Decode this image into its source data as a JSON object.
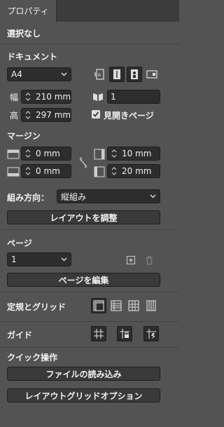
{
  "tab": {
    "label": "プロパティ"
  },
  "selection": {
    "label": "選択なし"
  },
  "document": {
    "header": "ドキュメント",
    "page_size": "A4",
    "width_label": "幅",
    "width_value": "210 mm",
    "height_label": "高",
    "height_value": "297 mm",
    "pages_value": "1",
    "facing_pages": {
      "label": "見開きページ",
      "checked": true
    }
  },
  "margins": {
    "header": "マージン",
    "top": "0 mm",
    "bottom": "0 mm",
    "inside": "10 mm",
    "outside": "20 mm"
  },
  "direction": {
    "label": "組み方向：",
    "value": "縦組み"
  },
  "layout_adjust": {
    "label": "レイアウトを調整"
  },
  "pages": {
    "header": "ページ",
    "current": "1",
    "edit_label": "ページを編集"
  },
  "grids": {
    "header": "定規とグリッド"
  },
  "guides": {
    "header": "ガイド"
  },
  "quick_actions": {
    "header": "クイック操作",
    "import_file": "ファイルの読み込み",
    "layout_grid_options": "レイアウトグリッドオプション"
  },
  "colors": {
    "panel_bg": "#535353",
    "field_bg": "#2d2d2d",
    "tabbar_bg": "#3c3c3c"
  }
}
